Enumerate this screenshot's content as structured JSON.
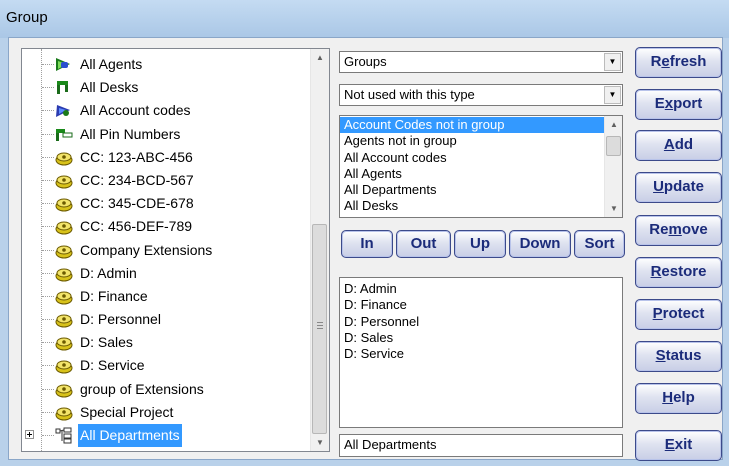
{
  "window": {
    "title": "Group"
  },
  "tree": {
    "items": [
      {
        "label": "All Agents",
        "icon": "agents-icon"
      },
      {
        "label": "All Desks",
        "icon": "desks-icon"
      },
      {
        "label": "All Account codes",
        "icon": "account-codes-icon"
      },
      {
        "label": "All Pin Numbers",
        "icon": "pin-numbers-icon"
      },
      {
        "label": "CC: 123-ABC-456",
        "icon": "phone-group-icon"
      },
      {
        "label": "CC: 234-BCD-567",
        "icon": "phone-group-icon"
      },
      {
        "label": "CC: 345-CDE-678",
        "icon": "phone-group-icon"
      },
      {
        "label": "CC: 456-DEF-789",
        "icon": "phone-group-icon"
      },
      {
        "label": "Company Extensions",
        "icon": "phone-group-icon"
      },
      {
        "label": "D: Admin",
        "icon": "phone-group-icon"
      },
      {
        "label": "D: Finance",
        "icon": "phone-group-icon"
      },
      {
        "label": "D: Personnel",
        "icon": "phone-group-icon"
      },
      {
        "label": "D: Sales",
        "icon": "phone-group-icon"
      },
      {
        "label": "D: Service",
        "icon": "phone-group-icon"
      },
      {
        "label": "group of Extensions",
        "icon": "phone-group-icon"
      },
      {
        "label": "Special Project",
        "icon": "phone-group-icon"
      },
      {
        "label": "All Departments",
        "icon": "departments-icon",
        "selected": true
      }
    ]
  },
  "type_combo": {
    "value": "Groups"
  },
  "filter_combo": {
    "value": "Not used with this type"
  },
  "available_list": {
    "items": [
      "Account Codes not in group",
      "Agents not in group",
      "All Account codes",
      "All Agents",
      "All Departments",
      "All Desks"
    ],
    "selected_index": 0
  },
  "move_buttons": {
    "in": "In",
    "out": "Out",
    "up": "Up",
    "down": "Down",
    "sort": "Sort"
  },
  "members_list": {
    "items": [
      "D: Admin",
      "D: Finance",
      "D: Personnel",
      "D: Sales",
      "D: Service"
    ]
  },
  "group_name_field": {
    "value": "All Departments"
  },
  "actions": {
    "refresh": {
      "pre": "R",
      "mn": "e",
      "post": "fresh"
    },
    "export": {
      "pre": "E",
      "mn": "x",
      "post": "port"
    },
    "add": {
      "pre": "",
      "mn": "A",
      "post": "dd"
    },
    "update": {
      "pre": "",
      "mn": "U",
      "post": "pdate"
    },
    "remove": {
      "pre": "Re",
      "mn": "m",
      "post": "ove"
    },
    "restore": {
      "pre": "",
      "mn": "R",
      "post": "estore"
    },
    "protect": {
      "pre": "",
      "mn": "P",
      "post": "rotect"
    },
    "status": {
      "pre": "",
      "mn": "S",
      "post": "tatus"
    },
    "help": {
      "pre": "",
      "mn": "H",
      "post": "elp"
    },
    "exit": {
      "pre": "",
      "mn": "E",
      "post": "xit"
    }
  },
  "colors": {
    "selection": "#3399ff",
    "button_text": "#1b2b7a",
    "title_bar": "#b9d1ea"
  }
}
